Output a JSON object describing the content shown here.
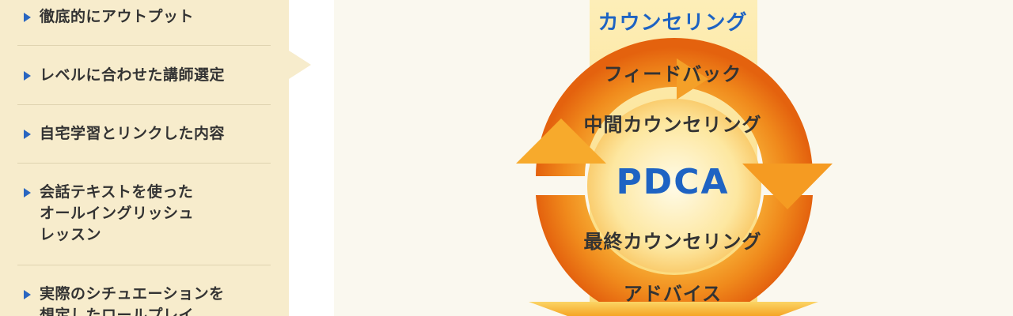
{
  "sidebar": {
    "items": [
      {
        "label": "徹底的にアウトプット"
      },
      {
        "label": "レベルに合わせた講師選定"
      },
      {
        "label": "自宅学習とリンクした内容"
      },
      {
        "label": "会話テキストを使った\nオールイングリッシュ\nレッスン"
      },
      {
        "label": "実際のシチュエーションを\n想定したロールプレイ"
      }
    ]
  },
  "diagram": {
    "top_label": "カウンセリング",
    "feedback": "フィードバック",
    "mid_counseling": "中間カウンセリング",
    "center": "PDCA",
    "final_counseling": "最終カウンセリング",
    "advice": "アドバイス"
  },
  "colors": {
    "accent_blue": "#1e63c3",
    "cycle_orange": "#f08a1c",
    "column_yellow": "#fbe39a",
    "panel_beige": "#f7eccc"
  }
}
